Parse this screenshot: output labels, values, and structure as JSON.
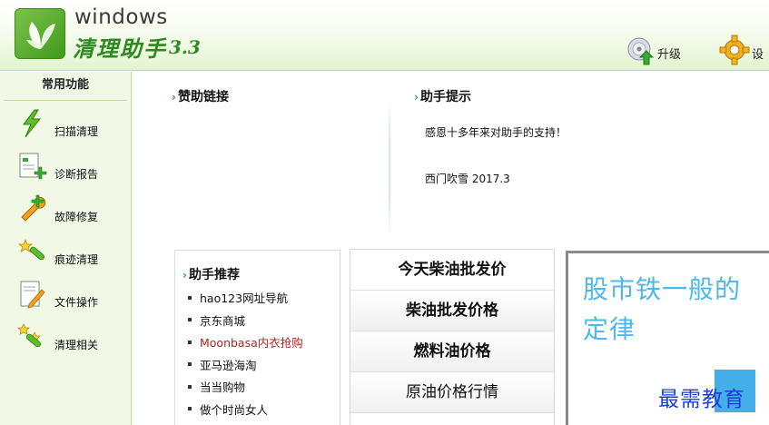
{
  "app": {
    "name_en": "windows",
    "name_cn": "清理助手",
    "version": "3.3"
  },
  "toolbar": {
    "upgrade_label": "升级",
    "settings_label": "设"
  },
  "sidebar": {
    "title": "常用功能",
    "items": [
      {
        "label": "扫描清理",
        "icon": "lightning-icon"
      },
      {
        "label": "诊断报告",
        "icon": "document-add-icon"
      },
      {
        "label": "故障修复",
        "icon": "wrench-plus-icon"
      },
      {
        "label": "痕迹清理",
        "icon": "brush-star-icon"
      },
      {
        "label": "文件操作",
        "icon": "file-edit-icon"
      },
      {
        "label": "清理相关",
        "icon": "multi-star-icon"
      }
    ]
  },
  "sponsor": {
    "title": "赞助链接"
  },
  "tips": {
    "title": "助手提示",
    "line1": "感恩十多年来对助手的支持！",
    "line2": "西门吹雪  2017.3"
  },
  "recommend": {
    "title": "助手推荐",
    "items": [
      {
        "label": "hao123网址导航"
      },
      {
        "label": "京东商城"
      },
      {
        "label": "Moonbasa内衣抢购"
      },
      {
        "label": "亚马逊海淘"
      },
      {
        "label": "当当购物"
      },
      {
        "label": "做个时尚女人"
      }
    ]
  },
  "oil_links": [
    {
      "label": "今天柴油批发价"
    },
    {
      "label": "柴油批发价格"
    },
    {
      "label": "燃料油价格"
    },
    {
      "label": "原油价格行情"
    }
  ],
  "ad": {
    "text": "股市铁一般的定律"
  },
  "watermark": {
    "text": "最需教育"
  },
  "colors": {
    "brand_green": "#2d8a1f",
    "sidebar_bg": "#f1f9e6",
    "link_highlight": "#b0231d",
    "ad_text": "#4fb8e8",
    "watermark_text": "#1b3fd0"
  }
}
